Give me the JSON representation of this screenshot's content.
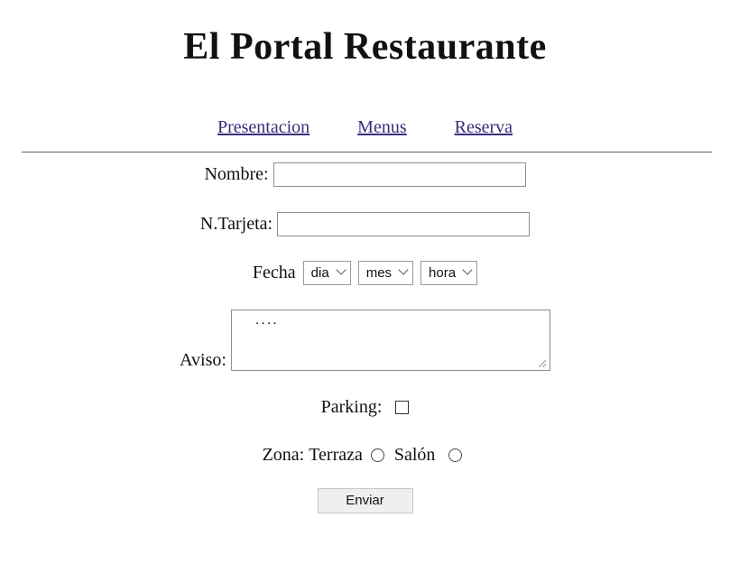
{
  "page": {
    "title": "El Portal Restaurante"
  },
  "nav": {
    "items": [
      {
        "label": "Presentacion"
      },
      {
        "label": "Menus"
      },
      {
        "label": "Reserva"
      }
    ],
    "link_color": "#3d2b7a"
  },
  "form": {
    "nombre": {
      "label": "Nombre:",
      "value": ""
    },
    "tarjeta": {
      "label": "N.Tarjeta:",
      "value": ""
    },
    "fecha": {
      "label": "Fecha",
      "dia": {
        "selected": "dia"
      },
      "mes": {
        "selected": "mes"
      },
      "hora": {
        "selected": "hora"
      }
    },
    "aviso": {
      "label": "Aviso:",
      "value": "...."
    },
    "parking": {
      "label": "Parking:",
      "checked": false
    },
    "zona": {
      "label": "Zona:",
      "options": [
        {
          "label": "Terraza",
          "checked": false
        },
        {
          "label": "Salón",
          "checked": false
        }
      ]
    },
    "submit_label": "Enviar"
  }
}
